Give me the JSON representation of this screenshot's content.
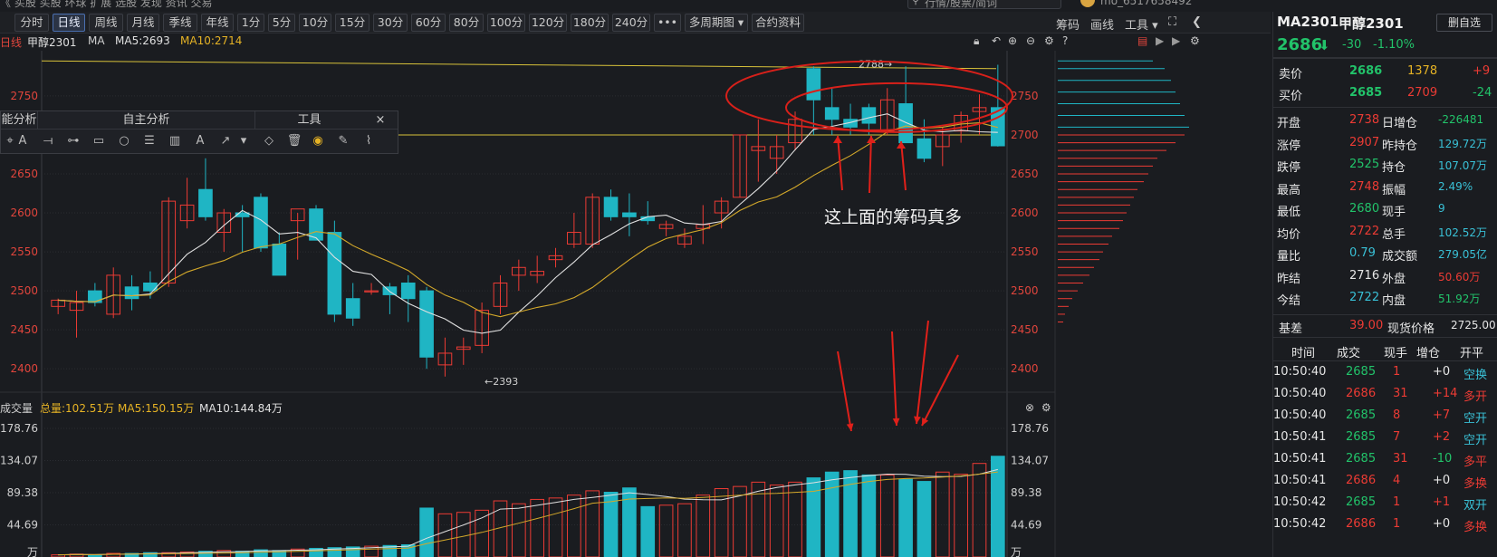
{
  "topbar": {
    "tabs": [
      "《",
      "买股",
      "买股",
      "环球",
      "扩展",
      "选股",
      "发现",
      "资讯",
      "交易"
    ],
    "search_placeholder": "行情/股票/简词",
    "user": "mo_6517658492"
  },
  "toolbar": {
    "intervals": [
      "分时",
      "日线",
      "周线",
      "月线",
      "季线",
      "年线",
      "1分",
      "5分",
      "10分",
      "15分",
      "30分",
      "60分",
      "80分",
      "100分",
      "120分",
      "180分",
      "240分"
    ],
    "more": "•••",
    "multi_period": "多周期图 ▾",
    "contract_info": "合约资料",
    "right_items": [
      "筹码",
      "画线",
      "工具 ▾"
    ]
  },
  "chart": {
    "period_label": "日线",
    "symbol": "甲醇2301",
    "ma_label": "MA",
    "ma5": "MA5:2693",
    "ma10": "MA10:2714",
    "y_ticks": [
      "2750",
      "2700",
      "2650",
      "2600",
      "2550",
      "2500",
      "2450",
      "2400"
    ],
    "high_marker": "2788→",
    "low_marker": "←2393",
    "annotation": "这上面的筹码真多",
    "colors": {
      "up": "#ec3b34",
      "down": "#1fb5c4",
      "ma5": "#e0e0e0",
      "ma10": "#d4a92a",
      "hline": "#d8c23a"
    }
  },
  "volume": {
    "label": "成交量",
    "total": "总量:102.51万",
    "ma5": "MA5:150.15万",
    "ma10": "MA10:144.84万",
    "y_ticks": [
      "178.76",
      "134.07",
      "89.38",
      "44.69",
      "万"
    ]
  },
  "analysis_toolbar": {
    "left_header": "能分析",
    "mid_header": "自主分析",
    "tool_header": "工具",
    "close": "×"
  },
  "right_panel": {
    "code": "MA2301",
    "name": "甲醇2301",
    "add_watch": "删自选",
    "price": "2686",
    "arrow": "⬇",
    "change": "-30",
    "change_pct": "-1.10%",
    "ask_label": "卖价",
    "ask_price": "2686",
    "ask_vol": "1378",
    "ask_extra": "+9",
    "bid_label": "买价",
    "bid_price": "2685",
    "bid_vol": "2709",
    "bid_extra": "-24",
    "stats": [
      {
        "l1": "开盘",
        "v1": "2738",
        "c1": "red",
        "l2": "日增仓",
        "v2": "-226481",
        "c2": "green"
      },
      {
        "l1": "涨停",
        "v1": "2907",
        "c1": "red",
        "l2": "昨持仓",
        "v2": "129.72万",
        "c2": "cyan"
      },
      {
        "l1": "跌停",
        "v1": "2525",
        "c1": "green",
        "l2": "持仓",
        "v2": "107.07万",
        "c2": "cyan"
      },
      {
        "l1": "最高",
        "v1": "2748",
        "c1": "red",
        "l2": "振幅",
        "v2": "2.49%",
        "c2": "cyan"
      },
      {
        "l1": "最低",
        "v1": "2680",
        "c1": "green",
        "l2": "现手",
        "v2": "9",
        "c2": "cyan"
      },
      {
        "l1": "均价",
        "v1": "2722",
        "c1": "red",
        "l2": "总手",
        "v2": "102.52万",
        "c2": "cyan"
      },
      {
        "l1": "量比",
        "v1": "0.79",
        "c1": "cyan",
        "l2": "成交额",
        "v2": "279.05亿",
        "c2": "cyan"
      },
      {
        "l1": "昨结",
        "v1": "2716",
        "c1": "white",
        "l2": "外盘",
        "v2": "50.60万",
        "c2": "red"
      },
      {
        "l1": "今结",
        "v1": "2722",
        "c1": "cyan",
        "l2": "内盘",
        "v2": "51.92万",
        "c2": "green"
      }
    ],
    "basis_label": "基差",
    "basis_value": "39.00",
    "spot_label": "现货价格",
    "spot_value": "2725.00",
    "tick_headers": [
      "时间",
      "成交",
      "现手",
      "增仓",
      "开平"
    ],
    "ticks": [
      {
        "t": "10:50:40",
        "p": "2685",
        "v": "1",
        "d": "+0",
        "k": "空换"
      },
      {
        "t": "10:50:40",
        "p": "2686",
        "v": "31",
        "d": "+14",
        "k": "多开"
      },
      {
        "t": "10:50:40",
        "p": "2685",
        "v": "8",
        "d": "+7",
        "k": "空开"
      },
      {
        "t": "10:50:41",
        "p": "2685",
        "v": "7",
        "d": "+2",
        "k": "空开"
      },
      {
        "t": "10:50:41",
        "p": "2685",
        "v": "31",
        "d": "-10",
        "k": "多平"
      },
      {
        "t": "10:50:41",
        "p": "2686",
        "v": "4",
        "d": "+0",
        "k": "多换"
      },
      {
        "t": "10:50:42",
        "p": "2685",
        "v": "1",
        "d": "+1",
        "k": "双开"
      },
      {
        "t": "10:50:42",
        "p": "2686",
        "v": "1",
        "d": "+0",
        "k": "多换"
      }
    ]
  },
  "chart_data": {
    "type": "candlestick",
    "candles": [
      [
        2480,
        2490,
        2470,
        2488
      ],
      [
        2475,
        2500,
        2440,
        2485
      ],
      [
        2500,
        2510,
        2480,
        2485
      ],
      [
        2470,
        2530,
        2465,
        2520
      ],
      [
        2505,
        2520,
        2475,
        2490
      ],
      [
        2510,
        2525,
        2490,
        2500
      ],
      [
        2510,
        2620,
        2505,
        2615
      ],
      [
        2590,
        2645,
        2580,
        2610
      ],
      [
        2630,
        2670,
        2590,
        2595
      ],
      [
        2575,
        2605,
        2550,
        2600
      ],
      [
        2600,
        2610,
        2550,
        2595
      ],
      [
        2620,
        2625,
        2550,
        2555
      ],
      [
        2560,
        2575,
        2520,
        2520
      ],
      [
        2590,
        2600,
        2540,
        2605
      ],
      [
        2605,
        2610,
        2580,
        2565
      ],
      [
        2575,
        2590,
        2460,
        2470
      ],
      [
        2490,
        2510,
        2455,
        2465
      ],
      [
        2500,
        2510,
        2495,
        2500
      ],
      [
        2505,
        2510,
        2470,
        2495
      ],
      [
        2510,
        2520,
        2460,
        2490
      ],
      [
        2500,
        2505,
        2400,
        2415
      ],
      [
        2405,
        2440,
        2390,
        2420
      ],
      [
        2425,
        2440,
        2405,
        2428
      ],
      [
        2430,
        2485,
        2420,
        2475
      ],
      [
        2480,
        2520,
        2470,
        2510
      ],
      [
        2520,
        2540,
        2500,
        2530
      ],
      [
        2520,
        2545,
        2510,
        2525
      ],
      [
        2540,
        2555,
        2530,
        2545
      ],
      [
        2560,
        2600,
        2555,
        2575
      ],
      [
        2560,
        2625,
        2555,
        2620
      ],
      [
        2620,
        2630,
        2590,
        2595
      ],
      [
        2600,
        2625,
        2570,
        2595
      ],
      [
        2595,
        2615,
        2585,
        2590
      ],
      [
        2580,
        2590,
        2570,
        2585
      ],
      [
        2560,
        2580,
        2555,
        2570
      ],
      [
        2580,
        2610,
        2560,
        2585
      ],
      [
        2600,
        2620,
        2580,
        2615
      ],
      [
        2620,
        2700,
        2620,
        2700
      ],
      [
        2680,
        2720,
        2640,
        2685
      ],
      [
        2670,
        2700,
        2650,
        2685
      ],
      [
        2690,
        2730,
        2680,
        2720
      ],
      [
        2785,
        2788,
        2700,
        2745
      ],
      [
        2735,
        2760,
        2700,
        2720
      ],
      [
        2720,
        2740,
        2700,
        2710
      ],
      [
        2735,
        2740,
        2700,
        2715
      ],
      [
        2705,
        2760,
        2700,
        2745
      ],
      [
        2740,
        2788,
        2700,
        2690
      ],
      [
        2695,
        2720,
        2665,
        2670
      ],
      [
        2685,
        2710,
        2660,
        2700
      ],
      [
        2705,
        2730,
        2690,
        2725
      ],
      [
        2730,
        2752,
        2700,
        2735
      ],
      [
        2735,
        2790,
        2685,
        2686
      ]
    ],
    "volumes": [
      3,
      4,
      3,
      5,
      5,
      6,
      6,
      7,
      8,
      9,
      8,
      10,
      9,
      11,
      12,
      13,
      14,
      15,
      16,
      17,
      68,
      60,
      62,
      65,
      78,
      74,
      80,
      82,
      86,
      92,
      90,
      96,
      70,
      72,
      74,
      86,
      95,
      98,
      104,
      100,
      104,
      110,
      118,
      120,
      114,
      114,
      108,
      105,
      118,
      115,
      130,
      140
    ]
  }
}
